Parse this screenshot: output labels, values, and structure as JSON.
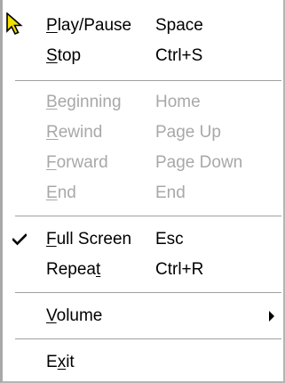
{
  "menu": {
    "items": [
      {
        "pre": "",
        "ul": "P",
        "post": "lay/Pause",
        "accel": "Space",
        "disabled": false
      },
      {
        "pre": "",
        "ul": "S",
        "post": "top",
        "accel": "Ctrl+S",
        "disabled": false
      },
      {
        "pre": "",
        "ul": "B",
        "post": "eginning",
        "accel": "Home",
        "disabled": true
      },
      {
        "pre": "",
        "ul": "R",
        "post": "ewind",
        "accel": "Page Up",
        "disabled": true
      },
      {
        "pre": "",
        "ul": "F",
        "post": "orward",
        "accel": "Page Down",
        "disabled": true
      },
      {
        "pre": "",
        "ul": "E",
        "post": "nd",
        "accel": "End",
        "disabled": true
      },
      {
        "pre": "",
        "ul": "F",
        "post": "ull Screen",
        "accel": "Esc",
        "disabled": false,
        "checked": true
      },
      {
        "pre": "Repea",
        "ul": "t",
        "post": "",
        "accel": "Ctrl+R",
        "disabled": false
      },
      {
        "pre": "",
        "ul": "V",
        "post": "olume",
        "accel": "",
        "disabled": false,
        "submenu": true
      },
      {
        "pre": "E",
        "ul": "x",
        "post": "it",
        "accel": "",
        "disabled": false
      }
    ]
  },
  "colors": {
    "text": "#000000",
    "disabled_text": "#a8a8a8",
    "cursor_fill": "#f2e000",
    "separator": "#a0a0a0"
  },
  "icons": {
    "cursor": "arrow-pointer-icon",
    "check": "checkmark-icon",
    "submenu": "submenu-arrow-icon"
  }
}
